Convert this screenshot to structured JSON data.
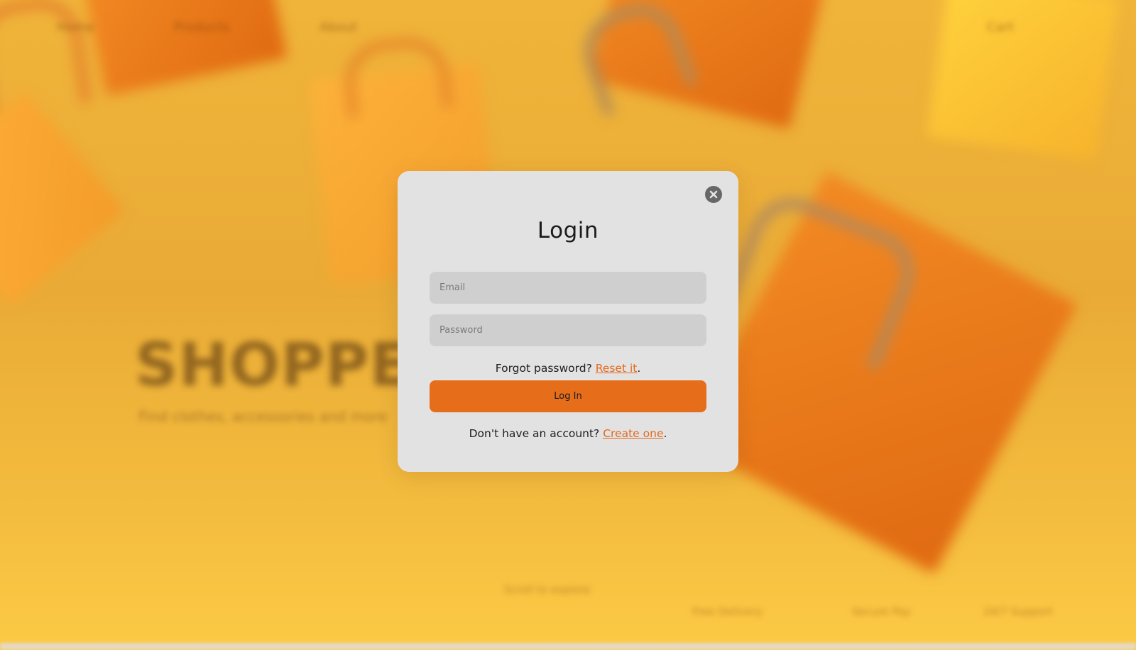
{
  "background": {
    "nav": {
      "items": [
        "Home",
        "Products",
        "About"
      ],
      "right_label": "Cart"
    },
    "hero": {
      "title": "SHOPPER",
      "subtitle": "Find clothes, accessories and more"
    },
    "footer": {
      "center_label": "Scroll to explore",
      "links": [
        "Free Delivery",
        "Secure Pay",
        "24/7 Support"
      ]
    },
    "colors": {
      "backdrop": "#f0b43a",
      "bag_orange": "#e06a12",
      "bag_light": "#f39b2a"
    }
  },
  "modal": {
    "title": "Login",
    "close_icon": "close-circle-icon",
    "email": {
      "value": "",
      "placeholder": "Email"
    },
    "password": {
      "value": "",
      "placeholder": "Password"
    },
    "forgot": {
      "prefix": "Forgot password? ",
      "link": "Reset it",
      "suffix": "."
    },
    "login_button": "Log In",
    "signup": {
      "prefix": "Don't have an account? ",
      "link": "Create one",
      "suffix": "."
    },
    "colors": {
      "panel": "#e2e2e2",
      "accent": "#e66d1a",
      "link": "#e4691c",
      "input": "#cfcfcf"
    }
  }
}
